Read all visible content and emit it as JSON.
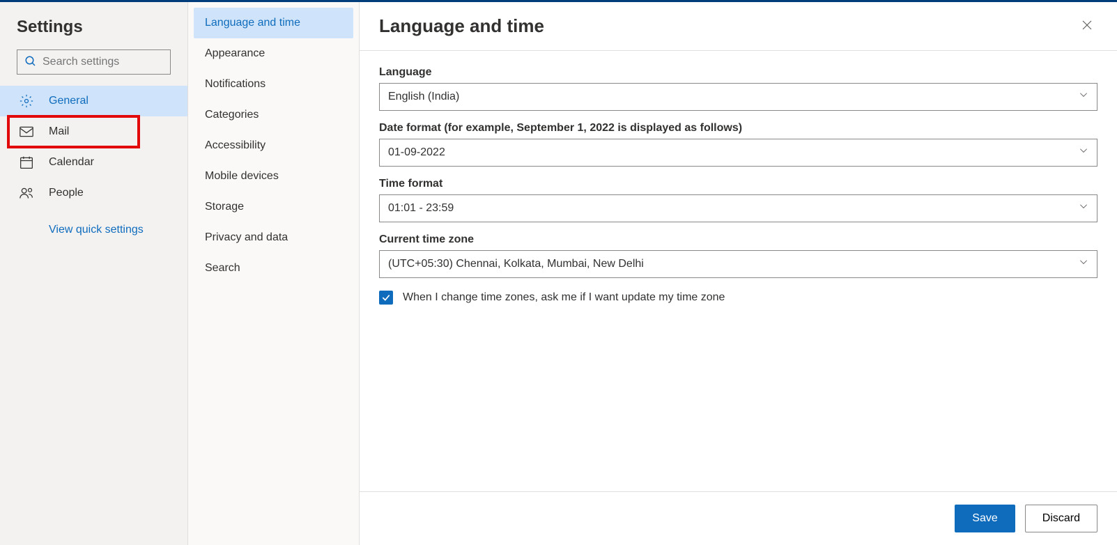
{
  "sidebar_left": {
    "title": "Settings",
    "search_placeholder": "Search settings",
    "items": [
      {
        "label": "General",
        "active": true
      },
      {
        "label": "Mail",
        "highlight": true
      },
      {
        "label": "Calendar"
      },
      {
        "label": "People"
      }
    ],
    "quick_link": "View quick settings"
  },
  "sidebar_mid": {
    "items": [
      {
        "label": "Language and time",
        "active": true
      },
      {
        "label": "Appearance"
      },
      {
        "label": "Notifications"
      },
      {
        "label": "Categories"
      },
      {
        "label": "Accessibility"
      },
      {
        "label": "Mobile devices"
      },
      {
        "label": "Storage"
      },
      {
        "label": "Privacy and data"
      },
      {
        "label": "Search"
      }
    ]
  },
  "main": {
    "title": "Language and time",
    "fields": {
      "language": {
        "label": "Language",
        "value": "English (India)"
      },
      "date_format": {
        "label": "Date format (for example, September 1, 2022 is displayed as follows)",
        "value": "01-09-2022"
      },
      "time_format": {
        "label": "Time format",
        "value": "01:01 - 23:59"
      },
      "timezone": {
        "label": "Current time zone",
        "value": "(UTC+05:30) Chennai, Kolkata, Mumbai, New Delhi"
      }
    },
    "checkbox_label": "When I change time zones, ask me if I want update my time zone",
    "save_label": "Save",
    "discard_label": "Discard"
  }
}
